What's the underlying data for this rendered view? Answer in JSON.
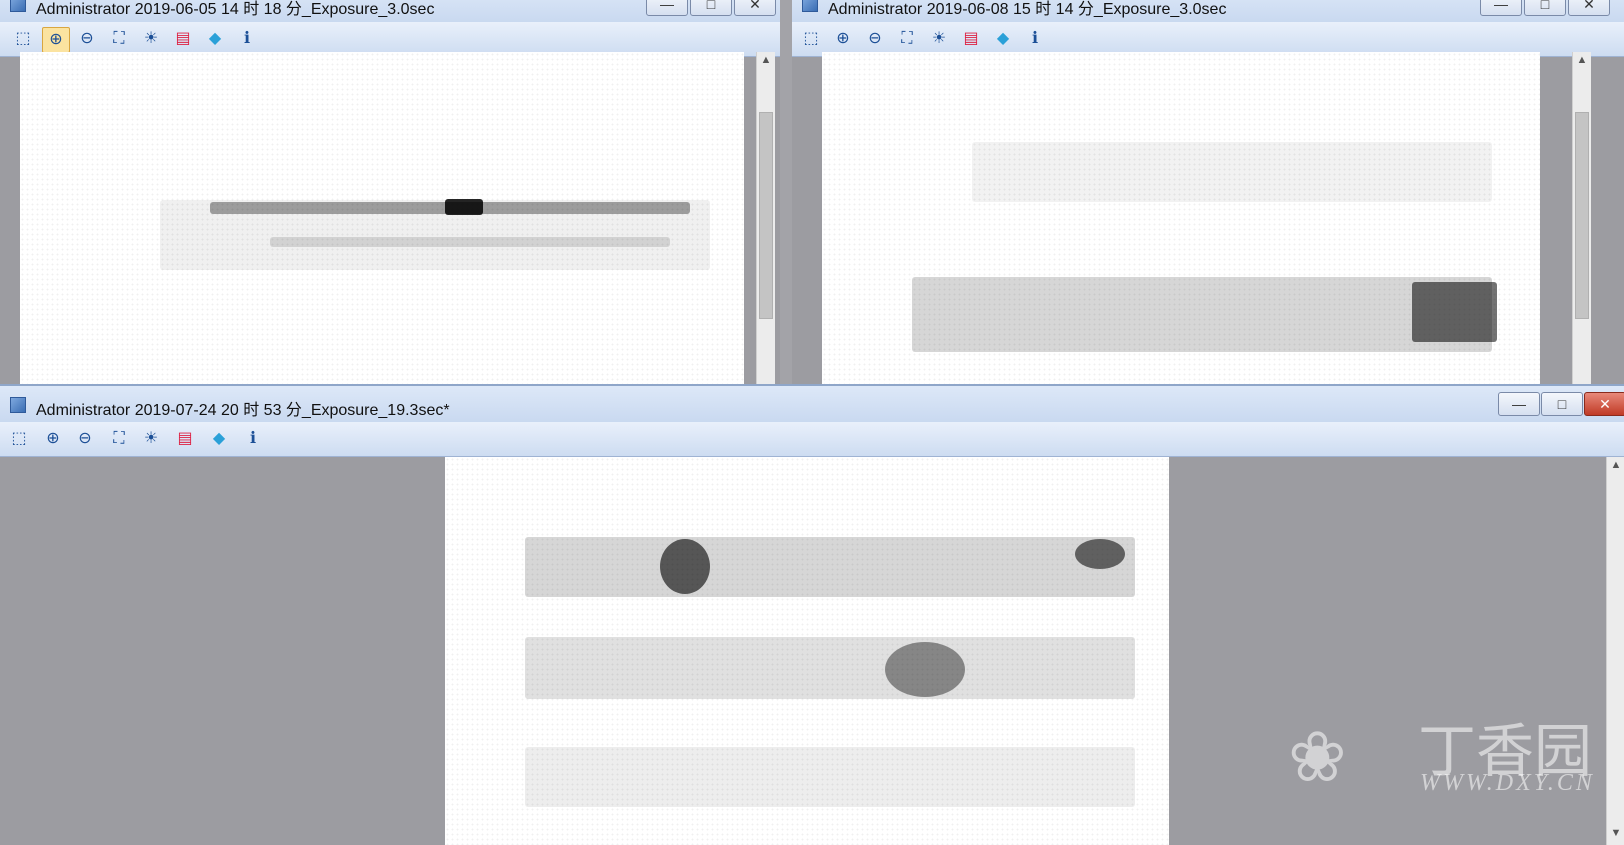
{
  "windows": {
    "top_left": {
      "title": "Administrator 2019-06-05 14 时 18 分_Exposure_3.0sec",
      "buttons": [
        "—",
        "□",
        "✕"
      ]
    },
    "top_right": {
      "title": "Administrator 2019-06-08 15 时 14 分_Exposure_3.0sec",
      "buttons": [
        "—",
        "□",
        "✕"
      ]
    },
    "bottom": {
      "title": "Administrator 2019-07-24 20 时 53 分_Exposure_19.3sec*",
      "buttons": [
        "—",
        "□",
        "✕"
      ]
    }
  },
  "toolbar_icons": [
    "image-select-icon",
    "zoom-in-icon",
    "zoom-out-icon",
    "fit-icon",
    "contrast-icon",
    "color-palette-icon",
    "diamond-icon",
    "info-icon"
  ],
  "toolbar_glyphs": [
    "⬚",
    "⊕",
    "⊖",
    "⛶",
    "☀",
    "▤",
    "◆",
    "ℹ"
  ],
  "active_tool_top_left": "zoom-in-icon",
  "watermark": {
    "chinese": "丁香园",
    "url": "WWW.DXY.CN"
  },
  "colors": {
    "titlebar": "#d7e3f5",
    "toolbar": "#dce7f7",
    "workspace": "#9c9ca1",
    "close_button": "#c94a36"
  }
}
